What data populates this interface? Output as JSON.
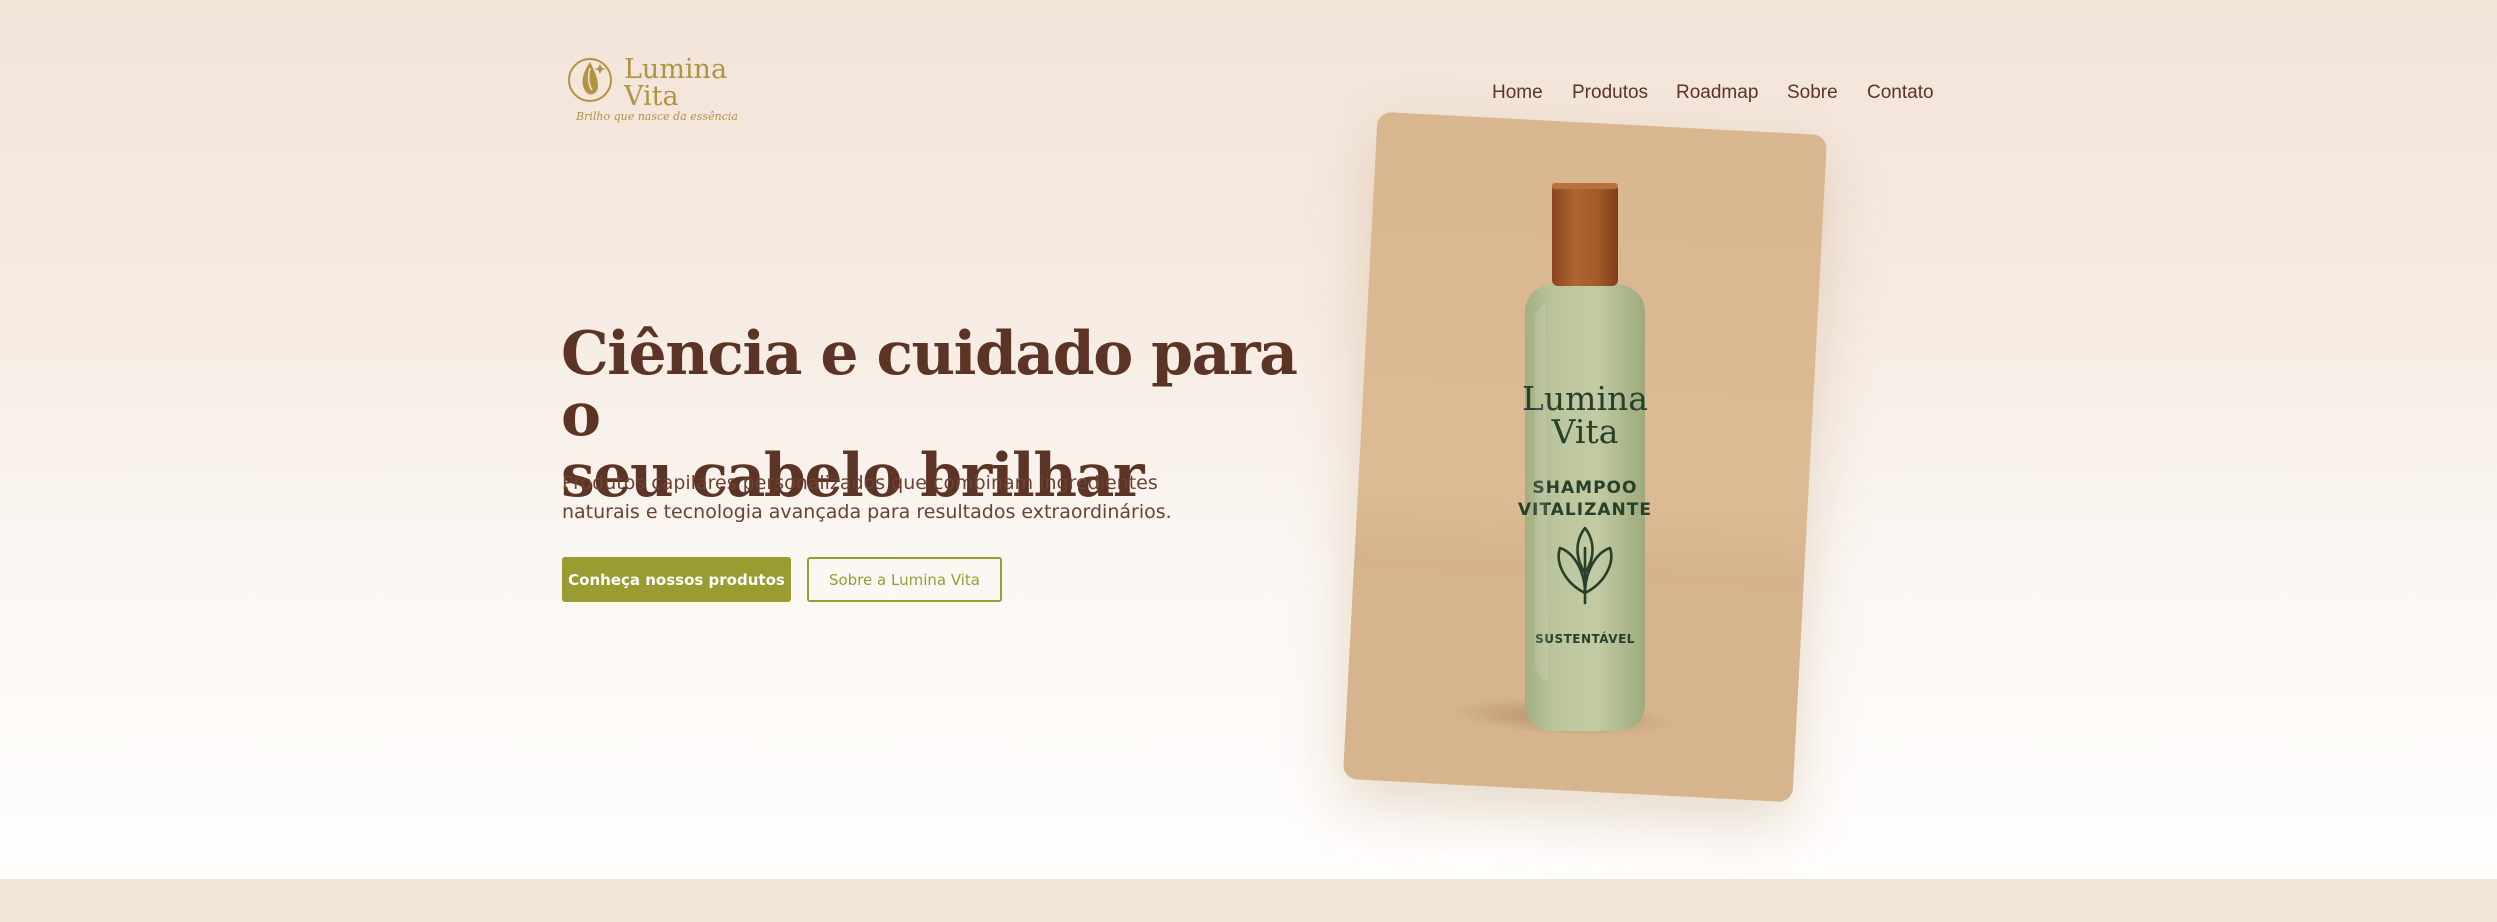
{
  "brand": {
    "name_line1": "Lumina",
    "name_line2": "Vita",
    "tagline": "Brilho que nasce da essência",
    "color": "#b19344"
  },
  "nav": {
    "items": [
      "Home",
      "Produtos",
      "Roadmap",
      "Sobre",
      "Contato"
    ]
  },
  "hero": {
    "headline_line1": "Ciência e cuidado para o",
    "headline_line2": "seu cabelo brilhar",
    "subtitle_line1": "Produtos capilares personalizados que combinam ingredientes",
    "subtitle_line2": "naturais e tecnologia avançada para resultados extraordinários.",
    "primary_button": "Conheça nossos produtos",
    "secondary_button": "Sobre a Lumina Vita"
  },
  "product_image": {
    "label_line1": "Lumina",
    "label_line2": "Vita",
    "product_line1": "SHAMPOO",
    "product_line2": "VITALIZANTE",
    "badge": "SUSTENTÁVEL",
    "icon": "leaf-icon"
  },
  "colors": {
    "text_brown": "#5c3426",
    "accent_olive": "#9a9c31",
    "bottle_green": "#b9c39a",
    "cap_wood": "#a4592a",
    "card_tan": "#d8b68f"
  }
}
